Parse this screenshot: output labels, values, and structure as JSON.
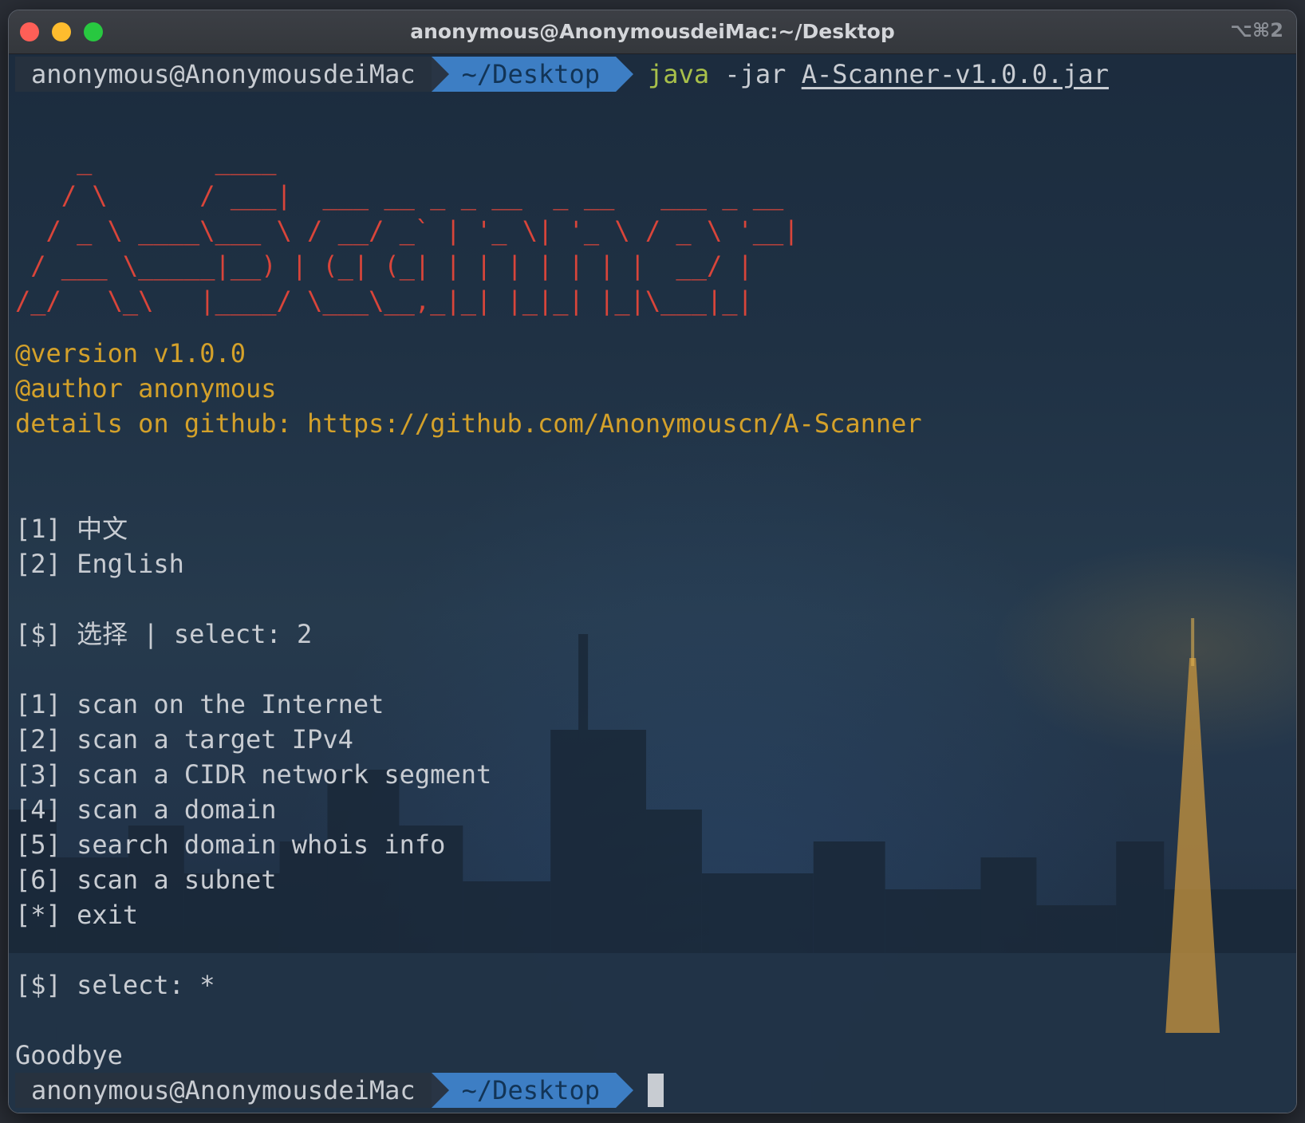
{
  "window": {
    "title": "anonymous@AnonymousdeiMac:~/Desktop",
    "shortcut": "⌥⌘2"
  },
  "prompt": {
    "user": "anonymous@AnonymousdeiMac",
    "dir": "~/Desktop"
  },
  "command": {
    "program": "java",
    "flag": "-jar",
    "file": "A-Scanner-v1.0.0.jar"
  },
  "banner_art": "    _        ____\n   / \\      / ___|  ___ __ _ _ __  _ __   ___ _ __\n  / _ \\ ____\\___ \\ / __/ _` | '_ \\| '_ \\ / _ \\ '__|\n / ___ \\_____|__) | (_| (_| | | | | | | |  __/ |\n/_/   \\_\\   |____/ \\___\\__,_|_| |_|_| |_|\\___|_|",
  "info": {
    "version": "@version v1.0.0",
    "author": "@author anonymous",
    "details": "details on github: https://github.com/Anonymouscn/A-Scanner"
  },
  "language_menu": {
    "items": [
      "[1] 中文",
      "[2] English"
    ],
    "select_prompt": "[$] 选择 | select: 2"
  },
  "main_menu": {
    "items": [
      "[1] scan on the Internet",
      "[2] scan a target IPv4",
      "[3] scan a CIDR network segment",
      "[4] scan a domain",
      "[5] search domain whois info",
      "[6] scan a subnet",
      "[*] exit"
    ],
    "select_prompt": "[$] select: *"
  },
  "farewell": "Goodbye",
  "colors": {
    "banner": "#d9453a",
    "info": "#d4a12a",
    "prompt_dir_bg": "#3d7ec4",
    "command_program": "#a8c04a"
  }
}
